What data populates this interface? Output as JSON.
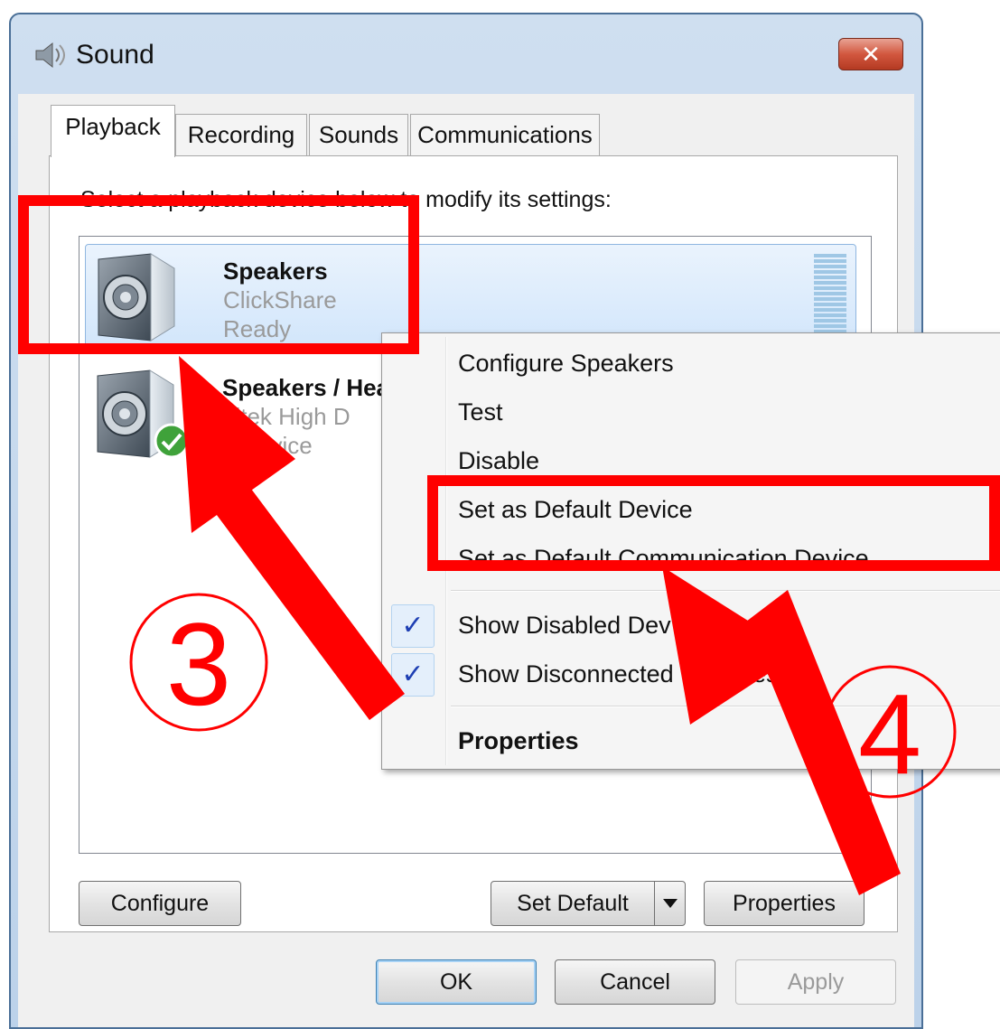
{
  "window": {
    "title": "Sound",
    "close_glyph": "✕"
  },
  "tabs": [
    {
      "label": "Playback",
      "active": true
    },
    {
      "label": "Recording",
      "active": false
    },
    {
      "label": "Sounds",
      "active": false
    },
    {
      "label": "Communications",
      "active": false
    }
  ],
  "playback": {
    "instructions": "Select a playback device below to modify its settings:",
    "devices": [
      {
        "name": "Speakers",
        "description": "ClickShare",
        "status": "Ready",
        "selected": true,
        "icon": "speaker-icon"
      },
      {
        "name": "Speakers / Hea",
        "description": "altek High D",
        "status": "lt Device",
        "selected": false,
        "icon": "speaker-icon",
        "badge": "default-check-icon"
      }
    ]
  },
  "context_menu": {
    "items": [
      {
        "label": "Configure Speakers"
      },
      {
        "label": "Test"
      },
      {
        "label": "Disable"
      },
      {
        "label": "Set as Default Device"
      },
      {
        "label": "Set as Default Communication Device"
      },
      {
        "label": "Show Disabled Dev",
        "checked": true
      },
      {
        "label": "Show Disconnected",
        "trailing": "es",
        "checked": true
      },
      {
        "label": "Properties",
        "bold": true
      }
    ],
    "check_glyph": "✓"
  },
  "buttons": {
    "configure": "Configure",
    "set_default": "Set Default",
    "properties": "Properties",
    "ok": "OK",
    "cancel": "Cancel",
    "apply": "Apply"
  },
  "annotations": {
    "step3_label": "3",
    "step4_label": "4",
    "color": "#ff0000"
  },
  "colors": {
    "selection": "#d2e6fb",
    "title_bar": "#bcd2ea",
    "close_button": "#c8462c"
  }
}
